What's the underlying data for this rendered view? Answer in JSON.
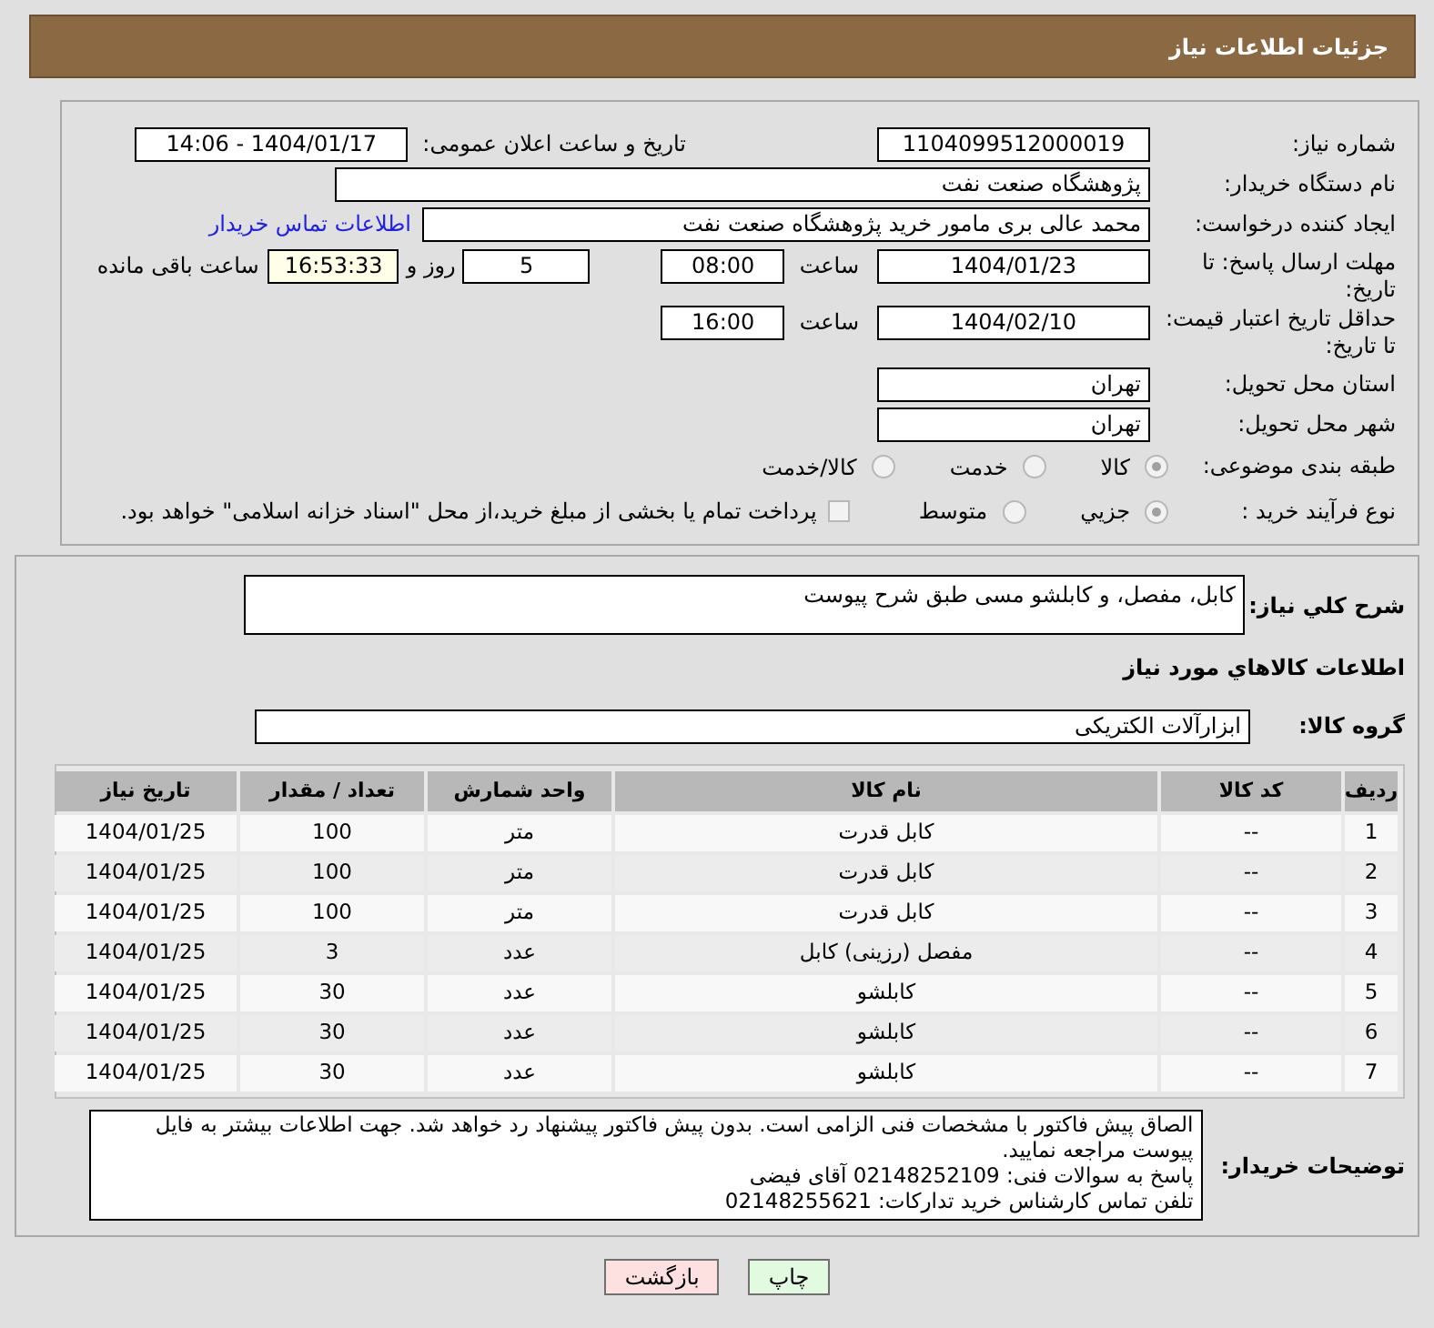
{
  "header": {
    "title": "جزئیات اطلاعات نیاز"
  },
  "need_number": {
    "label": "شماره نیاز:",
    "value": "1104099512000019"
  },
  "announce": {
    "label": "تاریخ و ساعت اعلان عمومی:",
    "value": "1404/01/17 - 14:06"
  },
  "buyer_org": {
    "label": "نام دستگاه خریدار:",
    "value": "پژوهشگاه صنعت نفت"
  },
  "requester": {
    "label": "ایجاد کننده درخواست:",
    "value": "محمد عالی بری مامور خرید پژوهشگاه صنعت نفت",
    "link": "اطلاعات تماس خریدار"
  },
  "deadline": {
    "label": "مهلت ارسال پاسخ: تا تاریخ:",
    "date": "1404/01/23",
    "time_label": "ساعت",
    "time": "08:00",
    "days": "5",
    "days_label": "روز و",
    "remaining": "16:53:33",
    "remaining_label": "ساعت باقی مانده"
  },
  "validity": {
    "label": "حداقل تاریخ اعتبار قیمت: تا تاریخ:",
    "date": "1404/02/10",
    "time_label": "ساعت",
    "time": "16:00"
  },
  "province": {
    "label": "استان محل تحویل:",
    "value": "تهران"
  },
  "city": {
    "label": "شهر محل تحویل:",
    "value": "تهران"
  },
  "category": {
    "label": "طبقه بندی موضوعی:",
    "options": [
      {
        "label": "کالا",
        "selected": true
      },
      {
        "label": "خدمت",
        "selected": false
      },
      {
        "label": "کالا/خدمت",
        "selected": false
      }
    ]
  },
  "process": {
    "label": "نوع فرآیند خرید :",
    "options": [
      {
        "label": "جزیي",
        "selected": true
      },
      {
        "label": "متوسط",
        "selected": false
      }
    ],
    "payment": {
      "label": "پرداخت تمام یا بخشی از مبلغ خرید،از محل \"اسناد خزانه اسلامی\" خواهد بود.",
      "checked": false
    }
  },
  "description": {
    "label": "شرح کلي نياز:",
    "value": "کابل، مفصل، و کابلشو مسی طبق شرح پیوست"
  },
  "goods_title": "اطلاعات کالاهاي مورد نياز",
  "group": {
    "label": "گروه کالا:",
    "value": "ابزارآلات الکتریکی"
  },
  "table": {
    "columns": [
      "ردیف",
      "کد کالا",
      "نام کالا",
      "واحد شمارش",
      "تعداد / مقدار",
      "تاریخ نیاز"
    ],
    "rows": [
      [
        "1",
        "--",
        "کابل قدرت",
        "متر",
        "100",
        "1404/01/25"
      ],
      [
        "2",
        "--",
        "کابل قدرت",
        "متر",
        "100",
        "1404/01/25"
      ],
      [
        "3",
        "--",
        "کابل قدرت",
        "متر",
        "100",
        "1404/01/25"
      ],
      [
        "4",
        "--",
        "مفصل (رزینی) کابل",
        "عدد",
        "3",
        "1404/01/25"
      ],
      [
        "5",
        "--",
        "کابلشو",
        "عدد",
        "30",
        "1404/01/25"
      ],
      [
        "6",
        "--",
        "کابلشو",
        "عدد",
        "30",
        "1404/01/25"
      ],
      [
        "7",
        "--",
        "کابلشو",
        "عدد",
        "30",
        "1404/01/25"
      ]
    ]
  },
  "notes": {
    "label": "توضیحات خریدار:",
    "lines": [
      "الصاق پیش فاکتور با مشخصات فنی الزامی است. بدون پیش فاکتور پیشنهاد رد خواهد شد. جهت اطلاعات بیشتر به فایل پیوست مراجعه نمایید.",
      "پاسخ به سوالات فنی: 02148252109 آقای فیضی",
      "تلفن تماس کارشناس خرید تدارکات: 02148255621"
    ]
  },
  "buttons": [
    {
      "label": "چاپ",
      "kind": "print"
    },
    {
      "label": "بازگشت",
      "kind": "back"
    }
  ]
}
